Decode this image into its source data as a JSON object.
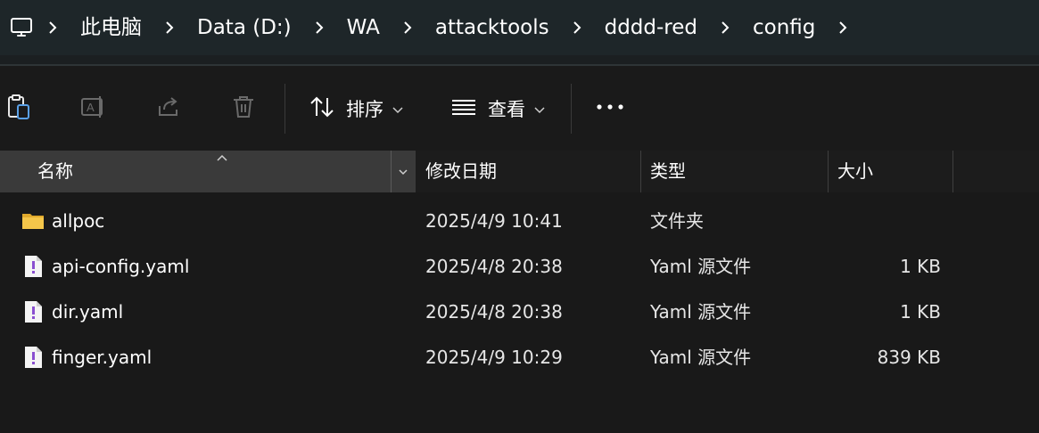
{
  "breadcrumb": {
    "items": [
      "此电脑",
      "Data (D:)",
      "WA",
      "attacktools",
      "dddd-red",
      "config"
    ]
  },
  "toolbar": {
    "sort_label": "排序",
    "view_label": "查看",
    "more_label": "..."
  },
  "columns": {
    "name": "名称",
    "date": "修改日期",
    "type": "类型",
    "size": "大小"
  },
  "files": [
    {
      "name": "allpoc",
      "date": "2025/4/9 10:41",
      "type": "文件夹",
      "size": "",
      "kind": "folder-icon"
    },
    {
      "name": "api-config.yaml",
      "date": "2025/4/8 20:38",
      "type": "Yaml 源文件",
      "size": "1 KB",
      "kind": "yaml-file-icon"
    },
    {
      "name": "dir.yaml",
      "date": "2025/4/8 20:38",
      "type": "Yaml 源文件",
      "size": "1 KB",
      "kind": "yaml-file-icon"
    },
    {
      "name": "finger.yaml",
      "date": "2025/4/9 10:29",
      "type": "Yaml 源文件",
      "size": "839 KB",
      "kind": "yaml-file-icon"
    }
  ],
  "colors": {
    "address_bar": "#1e2629",
    "background": "#191919",
    "header_selected": "#3a3a3a",
    "folder": "#f4c64a",
    "yaml_mark": "#8a4fd0"
  }
}
